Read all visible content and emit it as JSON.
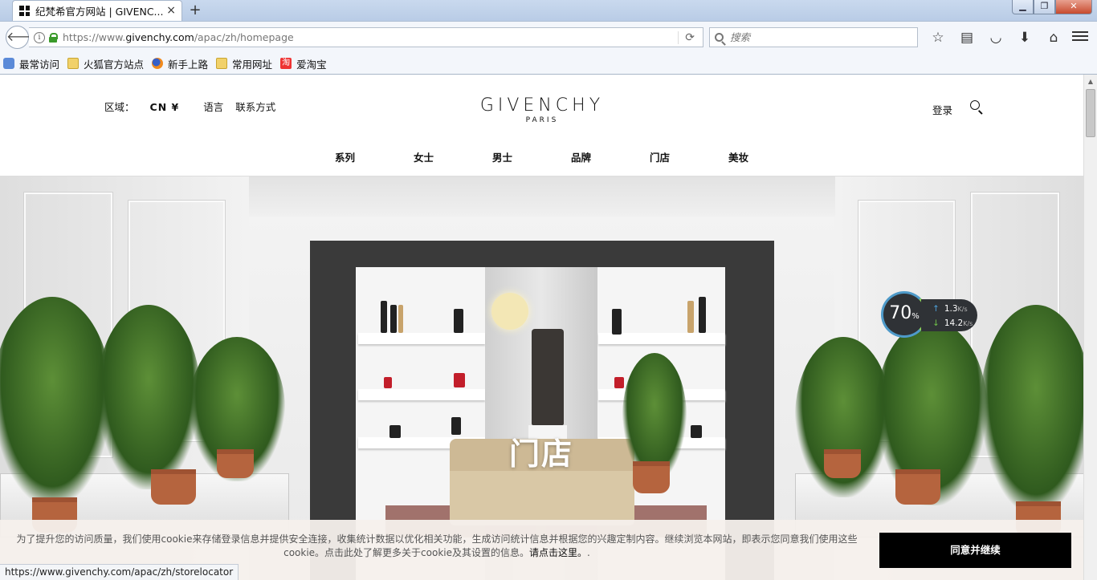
{
  "browser": {
    "tab_title": "纪梵希官方网站 | GIVENC...",
    "tab_close": "×",
    "new_tab": "+",
    "window_minimize": "▁",
    "window_restore": "❐",
    "window_close": "✕",
    "url_prefix": "https://www.",
    "url_domain": "givenchy.com",
    "url_path": "/apac/zh/homepage",
    "search_placeholder": "搜索",
    "bookmarks": [
      "最常访问",
      "火狐官方站点",
      "新手上路",
      "常用网址",
      "爱淘宝"
    ],
    "taobao_glyph": "淘",
    "status_url": "https://www.givenchy.com/apac/zh/storelocator"
  },
  "header": {
    "region_label": "区域：",
    "region_value": "CN ¥",
    "language": "语言",
    "contact": "联系方式",
    "logo": "GIVENCHY",
    "logo_sub": "PARIS",
    "login": "登录"
  },
  "nav": [
    "系列",
    "女士",
    "男士",
    "品牌",
    "门店",
    "美妆"
  ],
  "hero": {
    "title": "门店"
  },
  "speed_widget": {
    "percent": "70",
    "percent_unit": "%",
    "upload": "1.3",
    "download": "14.2",
    "unit": "K/s"
  },
  "cookie": {
    "text": "为了提升您的访问质量，我们使用cookie来存储登录信息并提供安全连接，收集统计数据以优化相关功能，生成访问统计信息并根据您的兴趣定制内容。继续浏览本网站，即表示您同意我们使用这些cookie。点击此处了解更多关于cookie及其设置的信息",
    "link": "请点击这里。",
    "tail": ".",
    "button": "同意并继续"
  },
  "colors": {
    "accent": "#000000",
    "cookie_bg": "#f5f0ec",
    "speed_ring": "#4e9ac9"
  }
}
